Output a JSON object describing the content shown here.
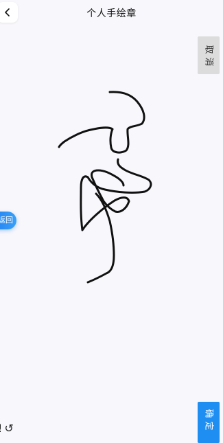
{
  "header": {
    "title": "个人手绘章"
  },
  "buttons": {
    "cancel": [
      "取",
      "消"
    ],
    "confirm": [
      "确",
      "定"
    ],
    "return_label": "返回"
  },
  "tools": {
    "clear_glyph": "!",
    "undo_glyph": "↺"
  },
  "colors": {
    "background": "#f8f7fb",
    "accent": "#1e8ef2",
    "cancel_bg": "#dcdcdc",
    "ink": "#111111"
  }
}
